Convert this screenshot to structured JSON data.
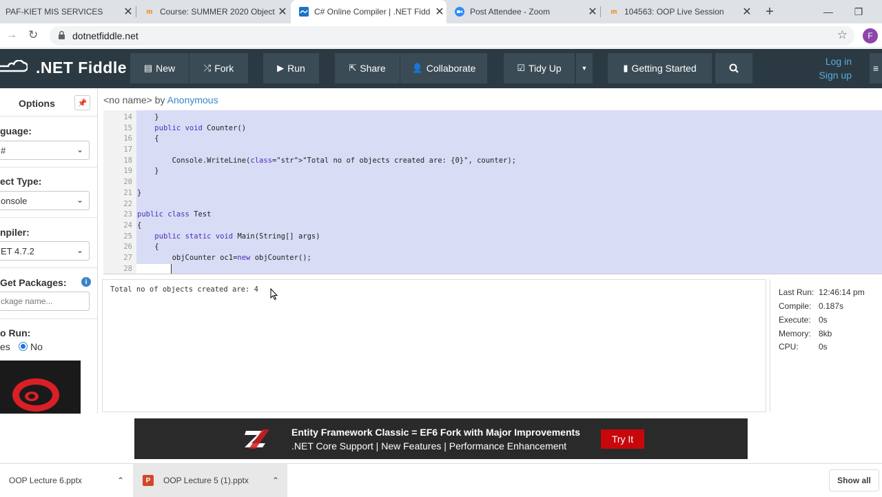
{
  "browser": {
    "tabs": [
      {
        "title": "PAF-KIET MIS SERVICES",
        "icon": "page-icon"
      },
      {
        "title": "Course: SUMMER 2020 Object",
        "icon": "moodle-icon"
      },
      {
        "title": "C# Online Compiler | .NET Fidd",
        "icon": "dotnetfiddle-icon",
        "active": true
      },
      {
        "title": "Post Attendee - Zoom",
        "icon": "zoom-icon"
      },
      {
        "title": "104563: OOP Live Session",
        "icon": "moodle-icon"
      }
    ],
    "url": "dotnetfiddle.net",
    "profile_initial": "F"
  },
  "navbar": {
    "brand": ".NET Fiddle",
    "new": "New",
    "fork": "Fork",
    "run": "Run",
    "share": "Share",
    "collaborate": "Collaborate",
    "tidy_up": "Tidy Up",
    "getting_started": "Getting Started",
    "log_in": "Log in",
    "sign_up": "Sign up"
  },
  "sidebar": {
    "title": "Options",
    "language_label": "guage:",
    "language_value": "#",
    "project_type_label": "ect Type:",
    "project_type_value": "onsole",
    "compiler_label": "npiler:",
    "compiler_value": "ET 4.7.2",
    "nuget_label": "Get Packages:",
    "nuget_placeholder": "ckage name...",
    "autorun_label": "o Run:",
    "autorun_yes": "es",
    "autorun_no": "No"
  },
  "editor": {
    "fiddle_name": "<no name>",
    "by": "by",
    "author": "Anonymous",
    "lines": [
      {
        "n": "14",
        "code": "    }"
      },
      {
        "n": "15",
        "code": "    public void Counter()"
      },
      {
        "n": "16",
        "code": "    {"
      },
      {
        "n": "17",
        "code": ""
      },
      {
        "n": "18",
        "code": "        Console.WriteLine(\"Total no of objects created are: {0}\", counter);"
      },
      {
        "n": "19",
        "code": "    }"
      },
      {
        "n": "20",
        "code": ""
      },
      {
        "n": "21",
        "code": "}"
      },
      {
        "n": "22",
        "code": ""
      },
      {
        "n": "23",
        "code": "public class Test"
      },
      {
        "n": "24",
        "code": "{"
      },
      {
        "n": "25",
        "code": "    public static void Main(String[] args)"
      },
      {
        "n": "26",
        "code": "    {"
      },
      {
        "n": "27",
        "code": "        objCounter oc1=new objCounter();"
      },
      {
        "n": "28",
        "code": ""
      }
    ]
  },
  "output": {
    "text": "Total no of objects created are: 4"
  },
  "stats": {
    "last_run_label": "Last Run:",
    "last_run": "12:46:14 pm",
    "compile_label": "Compile:",
    "compile": "0.187s",
    "execute_label": "Execute:",
    "execute": "0s",
    "memory_label": "Memory:",
    "memory": "8kb",
    "cpu_label": "CPU:",
    "cpu": "0s"
  },
  "ad": {
    "line1": "Entity Framework Classic = EF6 Fork with Major Improvements",
    "line2": ".NET Core Support | New Features | Performance Enhancement",
    "button": "Try It"
  },
  "downloads": {
    "items": [
      "OOP Lecture 6.pptx",
      "OOP Lecture 5 (1).pptx"
    ],
    "show_all": "Show all"
  },
  "colors": {
    "navbar_bg": "#2b3a42",
    "link": "#3a85c6",
    "selection": "#d9dcf5",
    "ad_button": "#c8070b"
  }
}
